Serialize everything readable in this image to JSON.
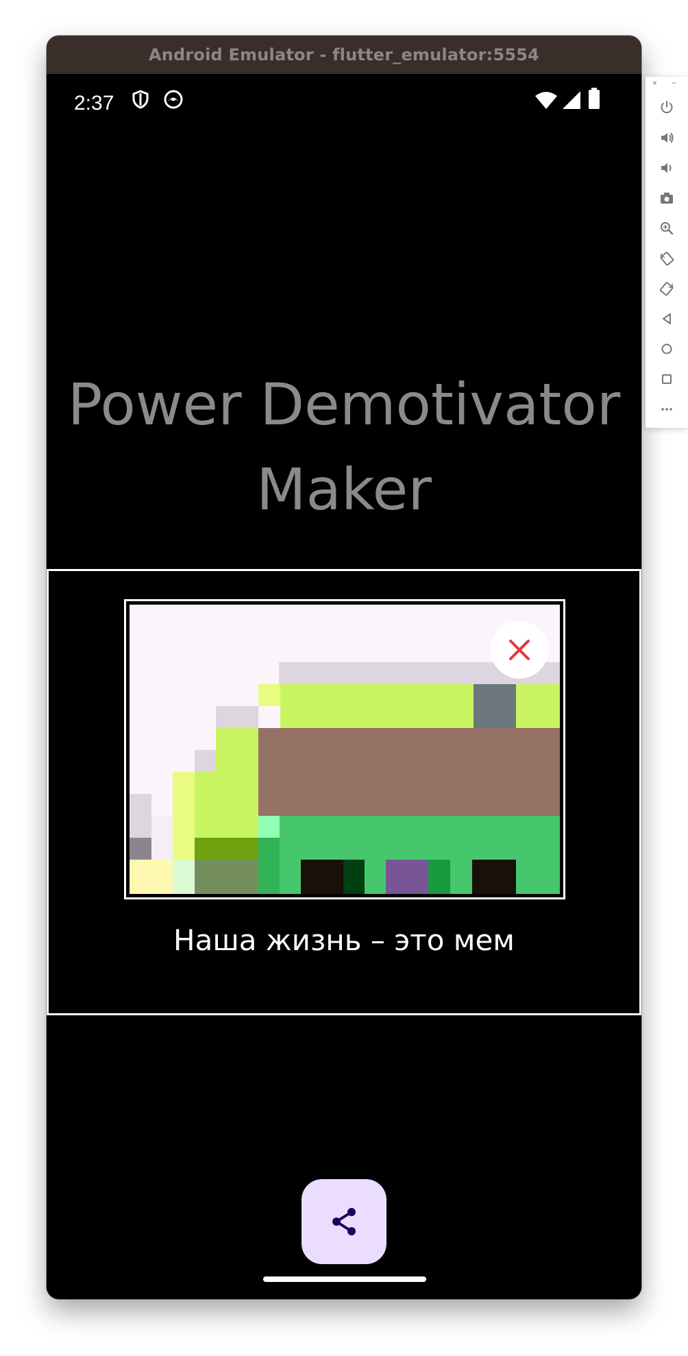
{
  "window": {
    "title": "Android Emulator - flutter_emulator:5554"
  },
  "status_bar": {
    "time": "2:37"
  },
  "app": {
    "title": "Power Demotivator Maker"
  },
  "demotivator": {
    "caption": "Наша жизнь – это мем"
  },
  "colors": {
    "fab_background": "#eaddff",
    "fab_icon": "#21005d",
    "close_x": "#e53935",
    "title_text": "#8a8a8a"
  },
  "icons": {
    "share": "share-icon",
    "close": "close-icon"
  },
  "emulator_toolbar": {
    "window_controls": [
      "×",
      "−"
    ],
    "buttons": [
      "power",
      "volume-up",
      "volume-down",
      "camera",
      "zoom",
      "rotate-left",
      "rotate-right",
      "back",
      "home",
      "overview",
      "more"
    ]
  }
}
